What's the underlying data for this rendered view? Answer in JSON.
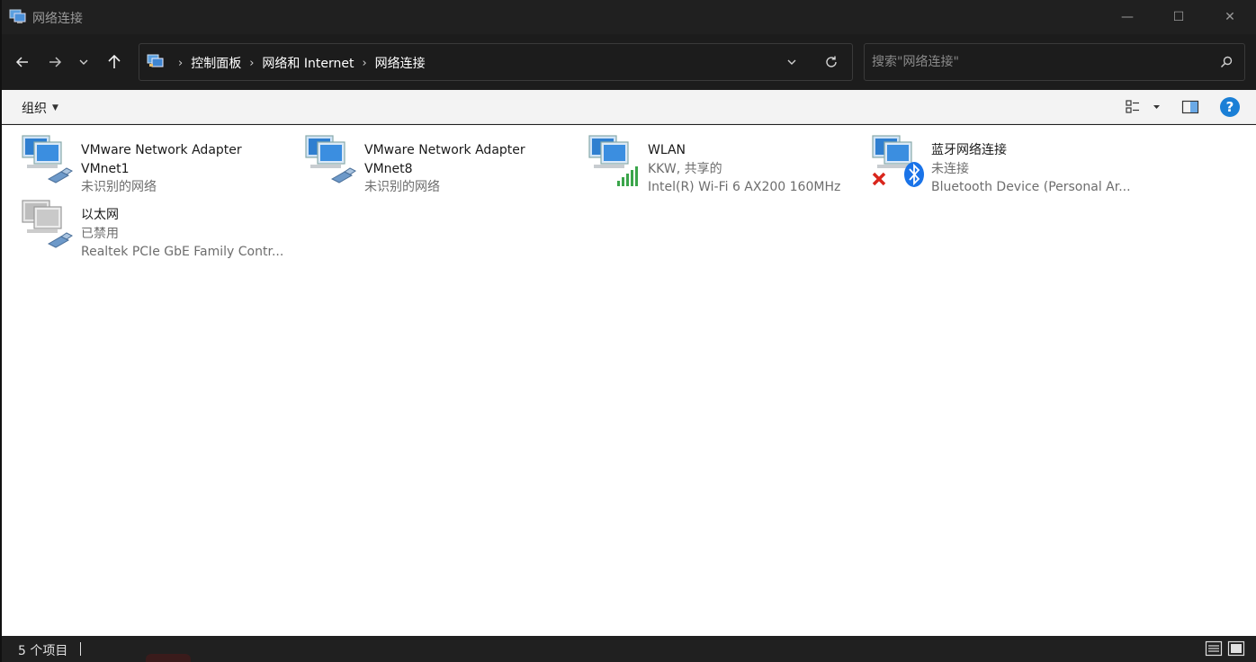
{
  "window": {
    "title": "网络连接",
    "controls": {
      "minimize": "—",
      "maximize": "☐",
      "close": "✕"
    }
  },
  "nav": {
    "back_icon": "arrow-left-icon",
    "forward_icon": "arrow-right-icon",
    "recent_icon": "chevron-down-icon",
    "up_icon": "arrow-up-icon"
  },
  "address": {
    "crumbs": [
      "控制面板",
      "网络和 Internet",
      "网络连接"
    ],
    "separator": "›"
  },
  "search": {
    "placeholder": "搜索\"网络连接\""
  },
  "commandbar": {
    "organize": "组织",
    "organize_caret": "▼",
    "help": "?"
  },
  "items": [
    {
      "name": "VMware Network Adapter",
      "name2": "VMnet1",
      "status": "未识别的网络",
      "device": "",
      "overlay": "cable"
    },
    {
      "name": "VMware Network Adapter",
      "name2": "VMnet8",
      "status": "未识别的网络",
      "device": "",
      "overlay": "cable"
    },
    {
      "name": "WLAN",
      "name2": "",
      "status": "KKW, 共享的",
      "device": "Intel(R) Wi-Fi 6 AX200 160MHz",
      "overlay": "wifi"
    },
    {
      "name": "蓝牙网络连接",
      "name2": "",
      "status": "未连接",
      "device": "Bluetooth Device (Personal Ar...",
      "overlay": "bluetooth"
    },
    {
      "name": "以太网",
      "name2": "",
      "status": "已禁用",
      "device": "Realtek PCIe GbE Family Contr...",
      "overlay": "cable-disabled"
    }
  ],
  "statusbar": {
    "count": "5 个项目"
  },
  "colors": {
    "accent": "#1a7fd6",
    "wifi_green": "#3aa54a",
    "error_red": "#d9261c",
    "bluetooth_blue": "#1a73e8"
  }
}
